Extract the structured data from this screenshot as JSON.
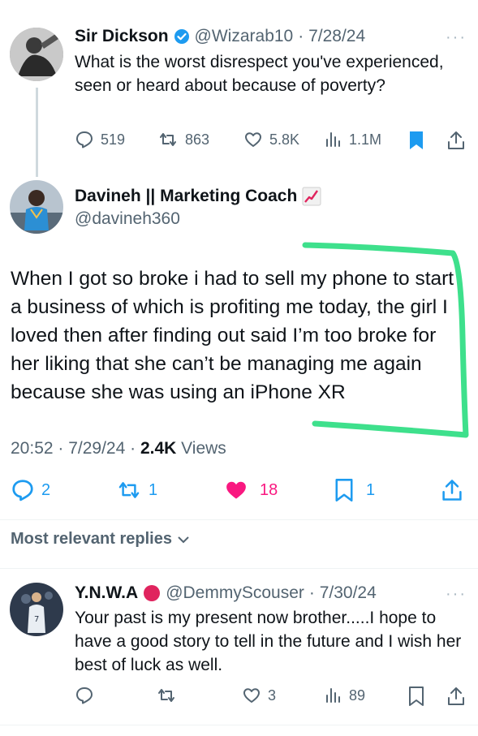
{
  "original_post": {
    "author_name": "Sir Dickson",
    "author_handle": "@Wizarab10",
    "date": "· 7/28/24",
    "text": "What is the worst disrespect you've experienced, seen or heard about because of poverty?",
    "replies": "519",
    "reposts": "863",
    "likes": "5.8K",
    "views": "1.1M",
    "more": "···"
  },
  "main_post": {
    "author_name": "Davineh || Marketing Coach",
    "author_handle": "@davineh360",
    "text": "When I got so broke i had to sell my phone to start a business of which is profiting me today, the girl I loved then after finding out said I’m too broke for her liking that she can’t be managing me again because she was using an iPhone XR",
    "timestamp": "20:52 · 7/29/24 · ",
    "views_count": "2.4K",
    "views_label": " Views",
    "replies": "2",
    "reposts": "1",
    "likes": "18",
    "bookmarks": "1",
    "like_color": "#f91880",
    "highlight_color": "#3ee08c"
  },
  "sort": {
    "label": "Most relevant replies"
  },
  "reply": {
    "author_name": "Y.N.W.A",
    "author_handle": "@DemmyScouser",
    "date": "· 7/30/24",
    "text": "Your past is my present now brother.....I hope to have a good story to tell in the future and I wish her best of luck as well.",
    "likes": "3",
    "views": "89",
    "more": "···"
  },
  "colors": {
    "accent": "#1d9bf0",
    "verified": "#1d9bf0",
    "secondary_text": "#536471",
    "red_badge": "#e0245e"
  }
}
